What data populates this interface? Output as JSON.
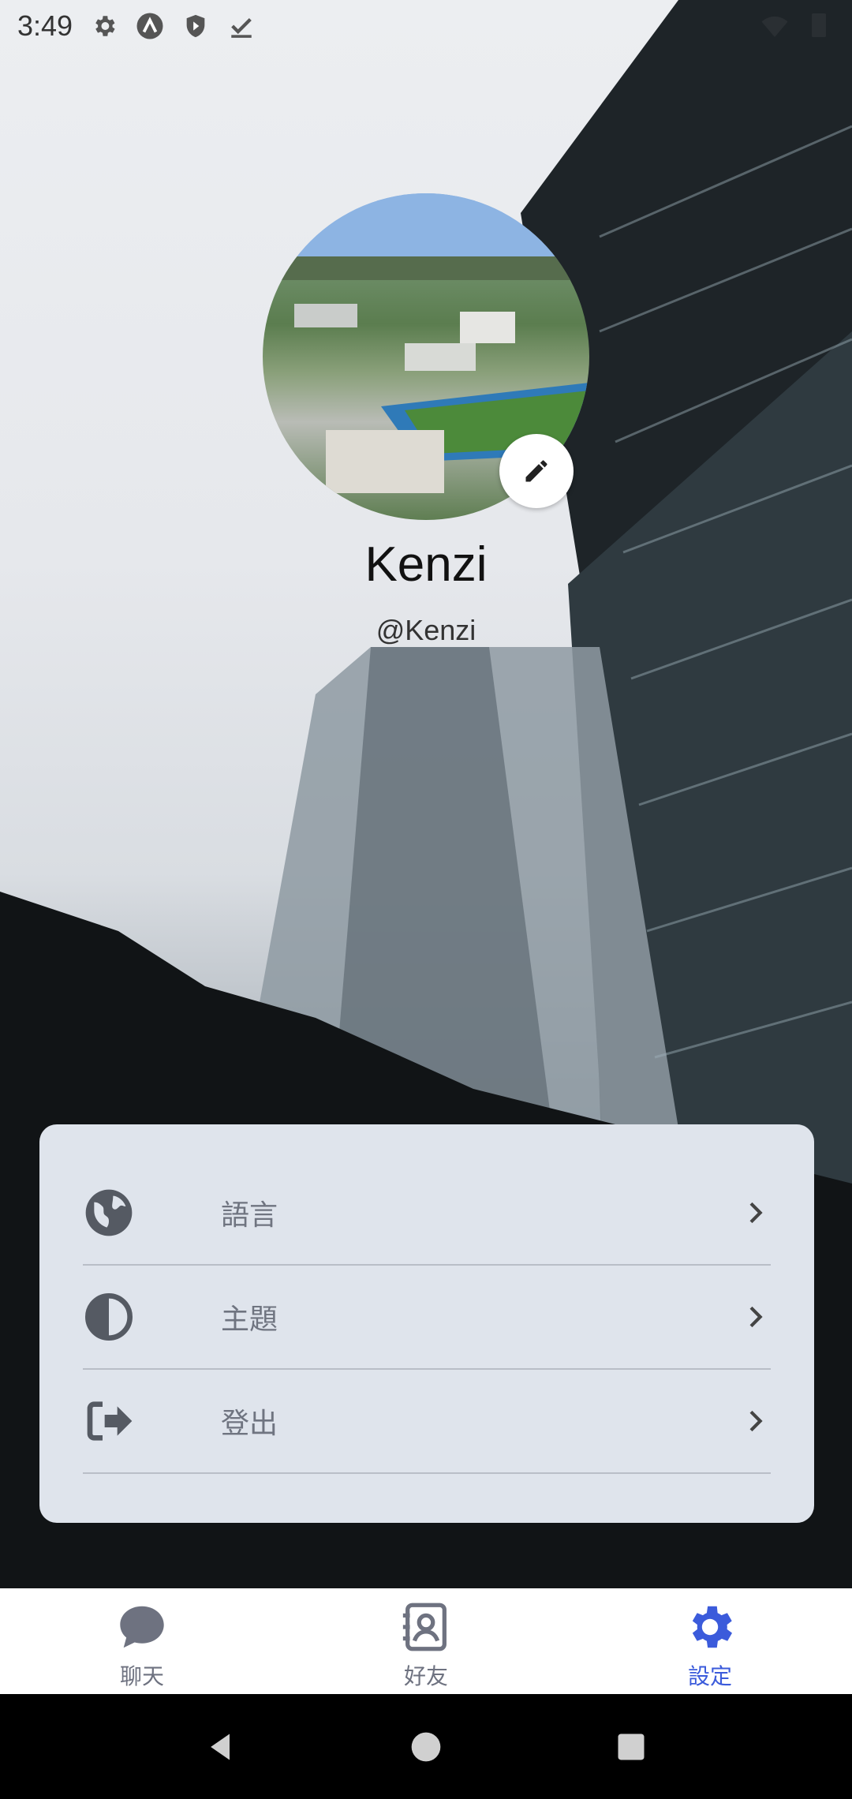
{
  "status_bar": {
    "time": "3:49",
    "icons": [
      "gear-icon",
      "a-badge-icon",
      "shield-icon",
      "download-check-icon"
    ]
  },
  "profile": {
    "name": "Kenzi",
    "handle": "@Kenzi",
    "edit_icon": "pencil-icon"
  },
  "settings": {
    "items": [
      {
        "label": "語言",
        "icon": "globe-icon"
      },
      {
        "label": "主題",
        "icon": "contrast-icon"
      },
      {
        "label": "登出",
        "icon": "logout-icon"
      }
    ]
  },
  "bottom_nav": {
    "items": [
      {
        "label": "聊天",
        "icon": "chat-bubble-icon",
        "active": false
      },
      {
        "label": "好友",
        "icon": "contacts-icon",
        "active": false
      },
      {
        "label": "設定",
        "icon": "settings-gear-icon",
        "active": true
      }
    ]
  },
  "colors": {
    "accent": "#3b5bdb",
    "card_background": "#dfe4ec",
    "nav_inactive": "#6e7280"
  }
}
